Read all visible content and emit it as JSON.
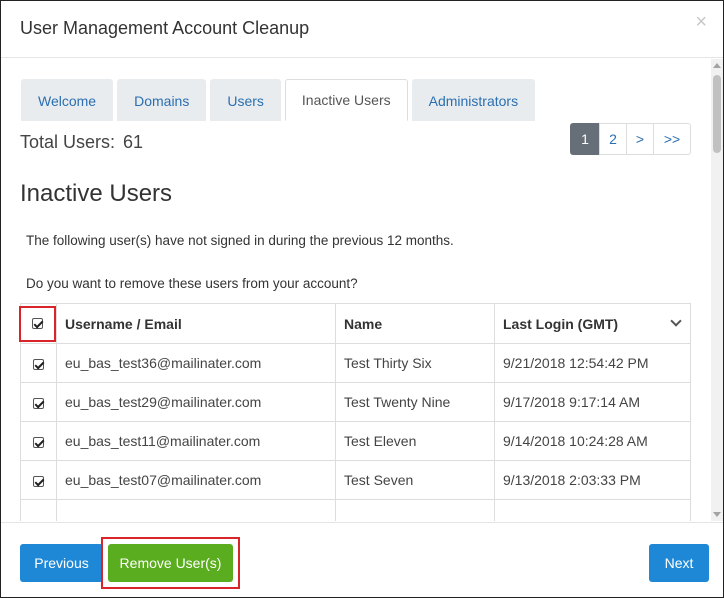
{
  "dialog": {
    "title": "User Management Account Cleanup",
    "close_label": "×"
  },
  "tabs": [
    {
      "label": "Welcome",
      "active": false
    },
    {
      "label": "Domains",
      "active": false
    },
    {
      "label": "Users",
      "active": false
    },
    {
      "label": "Inactive Users",
      "active": true
    },
    {
      "label": "Administrators",
      "active": false
    }
  ],
  "summary": {
    "total_label": "Total Users:",
    "total_value": "61"
  },
  "pagination": {
    "pages": [
      "1",
      "2",
      ">",
      ">>"
    ],
    "current": "1"
  },
  "section": {
    "title": "Inactive Users",
    "description": "The following user(s) have not signed in during the previous 12 months.",
    "question": "Do you want to remove these users from your account?"
  },
  "table": {
    "columns": [
      "Username / Email",
      "Name",
      "Last Login (GMT)"
    ],
    "rows": [
      {
        "email": "eu_bas_test36@mailinater.com",
        "name": "Test Thirty Six",
        "last_login": "9/21/2018 12:54:42 PM",
        "checked": true
      },
      {
        "email": "eu_bas_test29@mailinater.com",
        "name": "Test Twenty Nine",
        "last_login": "9/17/2018 9:17:14 AM",
        "checked": true
      },
      {
        "email": "eu_bas_test11@mailinater.com",
        "name": "Test Eleven",
        "last_login": "9/14/2018 10:24:28 AM",
        "checked": true
      },
      {
        "email": "eu_bas_test07@mailinater.com",
        "name": "Test Seven",
        "last_login": "9/13/2018 2:03:33 PM",
        "checked": true
      }
    ]
  },
  "footer": {
    "previous_label": "Previous",
    "remove_label": "Remove User(s)",
    "next_label": "Next"
  },
  "colors": {
    "primary": "#1f88d6",
    "success": "#59ad1e",
    "highlight": "#d9252a",
    "pager_active": "#666f78"
  }
}
